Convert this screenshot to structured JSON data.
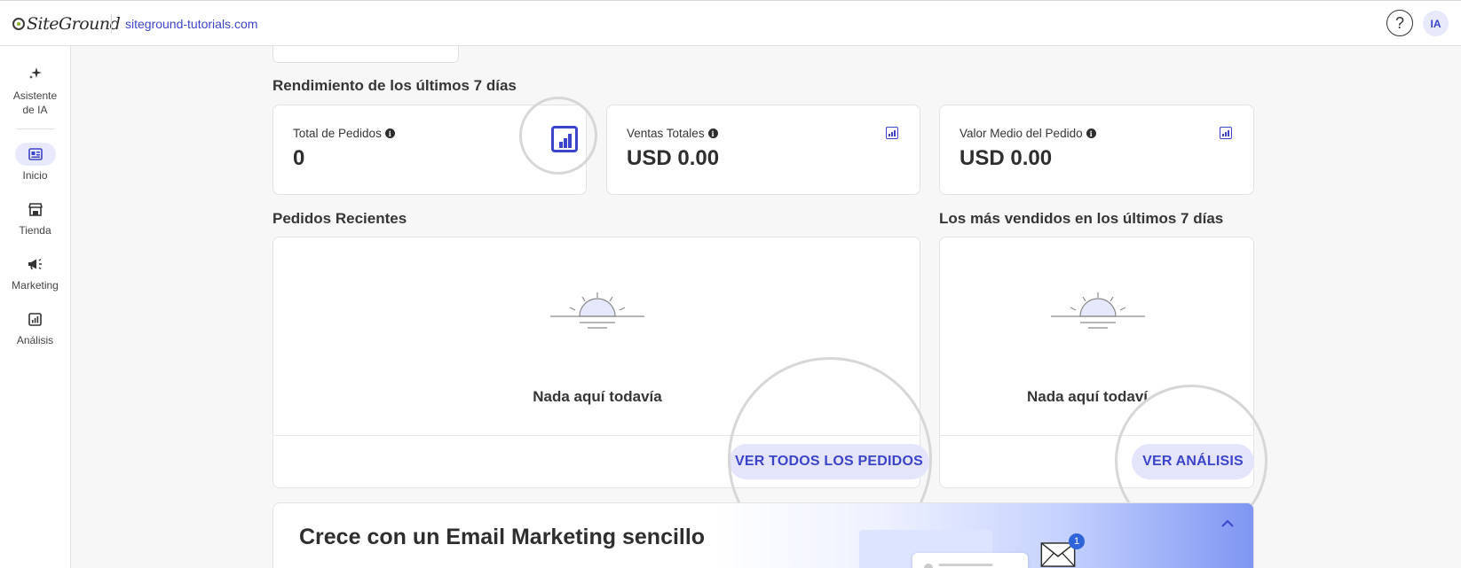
{
  "topbar": {
    "logo_text": "SiteGround",
    "site": "siteground-tutorials.com",
    "help_icon": "question-circle-icon",
    "avatar_initials": "IA"
  },
  "sidebar": {
    "items": [
      {
        "label": "Asistente de IA",
        "icon": "sparkle-icon"
      },
      {
        "label": "Inicio",
        "icon": "dashboard-icon",
        "active": true
      },
      {
        "label": "Tienda",
        "icon": "store-icon"
      },
      {
        "label": "Marketing",
        "icon": "megaphone-icon"
      },
      {
        "label": "Análisis",
        "icon": "analytics-icon"
      }
    ]
  },
  "performance": {
    "title": "Rendimiento de los últimos 7 días",
    "cards": [
      {
        "label": "Total de Pedidos",
        "value": "0",
        "info_icon": "i"
      },
      {
        "label": "Ventas Totales",
        "value": "USD 0.00",
        "info_icon": "i"
      },
      {
        "label": "Valor Medio del Pedido",
        "value": "USD 0.00",
        "info_icon": "i"
      }
    ]
  },
  "recent_orders": {
    "title": "Pedidos Recientes",
    "empty_text": "Nada aquí todavía",
    "button": "VER TODOS LOS PEDIDOS"
  },
  "best_sellers": {
    "title": "Los más vendidos en los últimos 7 días",
    "empty_text": "Nada aquí todaví",
    "button": "VER ANÁLISIS"
  },
  "banner": {
    "title": "Crece con un Email Marketing sencillo",
    "badge_count": "1",
    "collapse_icon": "chevron-up-icon"
  },
  "colors": {
    "accent": "#3c45c9",
    "button_bg": "#e4e5fb",
    "card_border": "#e3e3e3",
    "page_bg": "#f7f7f7"
  }
}
